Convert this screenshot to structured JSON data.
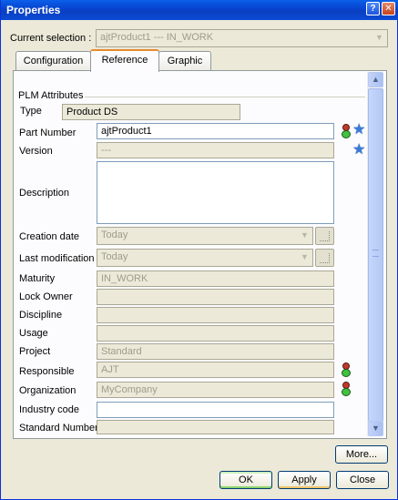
{
  "window": {
    "title": "Properties",
    "help_glyph": "?",
    "close_glyph": "✕"
  },
  "selection": {
    "label": "Current selection :",
    "value": "ajtProduct1 --- IN_WORK"
  },
  "tabs": [
    {
      "label": "Configuration",
      "active": false
    },
    {
      "label": "Reference",
      "active": true
    },
    {
      "label": "Graphic",
      "active": false
    }
  ],
  "section": {
    "title": "PLM Attributes"
  },
  "fields": {
    "type": {
      "label": "Type",
      "value": "Product DS"
    },
    "part_number": {
      "label": "Part Number",
      "value": "ajtProduct1"
    },
    "version": {
      "label": "Version",
      "value": "---"
    },
    "description": {
      "label": "Description",
      "value": ""
    },
    "creation_date": {
      "label": "Creation date",
      "value": "Today"
    },
    "last_modification": {
      "label": "Last modification",
      "value": "Today"
    },
    "maturity": {
      "label": "Maturity",
      "value": "IN_WORK"
    },
    "lock_owner": {
      "label": "Lock Owner",
      "value": ""
    },
    "discipline": {
      "label": "Discipline",
      "value": ""
    },
    "usage": {
      "label": "Usage",
      "value": ""
    },
    "project": {
      "label": "Project",
      "value": "Standard"
    },
    "responsible": {
      "label": "Responsible",
      "value": "AJT"
    },
    "organization": {
      "label": "Organization",
      "value": "MyCompany"
    },
    "industry_code": {
      "label": "Industry code",
      "value": ""
    },
    "standard_number": {
      "label": "Standard Number",
      "value": ""
    }
  },
  "buttons": {
    "more": "More...",
    "ok": "OK",
    "apply": "Apply",
    "close": "Close"
  },
  "icons": {
    "lamp": "status-lamp-icon",
    "star": "favorite-star-icon",
    "star_color": "#3a7bd5"
  }
}
